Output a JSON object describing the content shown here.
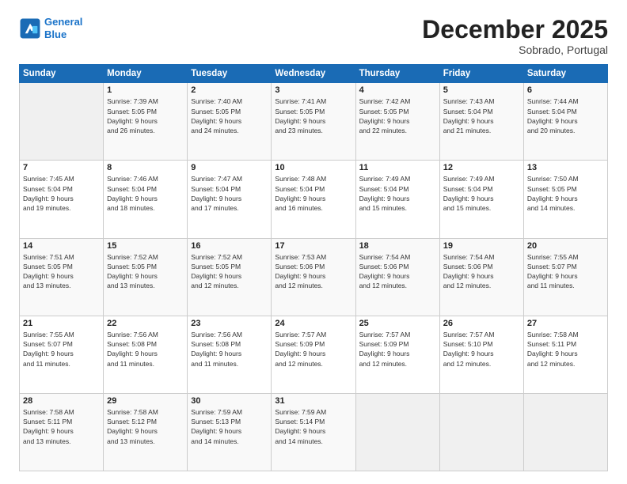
{
  "header": {
    "logo_line1": "General",
    "logo_line2": "Blue",
    "month_title": "December 2025",
    "subtitle": "Sobrado, Portugal"
  },
  "weekdays": [
    "Sunday",
    "Monday",
    "Tuesday",
    "Wednesday",
    "Thursday",
    "Friday",
    "Saturday"
  ],
  "weeks": [
    [
      {
        "day": "",
        "info": ""
      },
      {
        "day": "1",
        "info": "Sunrise: 7:39 AM\nSunset: 5:05 PM\nDaylight: 9 hours\nand 26 minutes."
      },
      {
        "day": "2",
        "info": "Sunrise: 7:40 AM\nSunset: 5:05 PM\nDaylight: 9 hours\nand 24 minutes."
      },
      {
        "day": "3",
        "info": "Sunrise: 7:41 AM\nSunset: 5:05 PM\nDaylight: 9 hours\nand 23 minutes."
      },
      {
        "day": "4",
        "info": "Sunrise: 7:42 AM\nSunset: 5:05 PM\nDaylight: 9 hours\nand 22 minutes."
      },
      {
        "day": "5",
        "info": "Sunrise: 7:43 AM\nSunset: 5:04 PM\nDaylight: 9 hours\nand 21 minutes."
      },
      {
        "day": "6",
        "info": "Sunrise: 7:44 AM\nSunset: 5:04 PM\nDaylight: 9 hours\nand 20 minutes."
      }
    ],
    [
      {
        "day": "7",
        "info": "Sunrise: 7:45 AM\nSunset: 5:04 PM\nDaylight: 9 hours\nand 19 minutes."
      },
      {
        "day": "8",
        "info": "Sunrise: 7:46 AM\nSunset: 5:04 PM\nDaylight: 9 hours\nand 18 minutes."
      },
      {
        "day": "9",
        "info": "Sunrise: 7:47 AM\nSunset: 5:04 PM\nDaylight: 9 hours\nand 17 minutes."
      },
      {
        "day": "10",
        "info": "Sunrise: 7:48 AM\nSunset: 5:04 PM\nDaylight: 9 hours\nand 16 minutes."
      },
      {
        "day": "11",
        "info": "Sunrise: 7:49 AM\nSunset: 5:04 PM\nDaylight: 9 hours\nand 15 minutes."
      },
      {
        "day": "12",
        "info": "Sunrise: 7:49 AM\nSunset: 5:04 PM\nDaylight: 9 hours\nand 15 minutes."
      },
      {
        "day": "13",
        "info": "Sunrise: 7:50 AM\nSunset: 5:05 PM\nDaylight: 9 hours\nand 14 minutes."
      }
    ],
    [
      {
        "day": "14",
        "info": "Sunrise: 7:51 AM\nSunset: 5:05 PM\nDaylight: 9 hours\nand 13 minutes."
      },
      {
        "day": "15",
        "info": "Sunrise: 7:52 AM\nSunset: 5:05 PM\nDaylight: 9 hours\nand 13 minutes."
      },
      {
        "day": "16",
        "info": "Sunrise: 7:52 AM\nSunset: 5:05 PM\nDaylight: 9 hours\nand 12 minutes."
      },
      {
        "day": "17",
        "info": "Sunrise: 7:53 AM\nSunset: 5:06 PM\nDaylight: 9 hours\nand 12 minutes."
      },
      {
        "day": "18",
        "info": "Sunrise: 7:54 AM\nSunset: 5:06 PM\nDaylight: 9 hours\nand 12 minutes."
      },
      {
        "day": "19",
        "info": "Sunrise: 7:54 AM\nSunset: 5:06 PM\nDaylight: 9 hours\nand 12 minutes."
      },
      {
        "day": "20",
        "info": "Sunrise: 7:55 AM\nSunset: 5:07 PM\nDaylight: 9 hours\nand 11 minutes."
      }
    ],
    [
      {
        "day": "21",
        "info": "Sunrise: 7:55 AM\nSunset: 5:07 PM\nDaylight: 9 hours\nand 11 minutes."
      },
      {
        "day": "22",
        "info": "Sunrise: 7:56 AM\nSunset: 5:08 PM\nDaylight: 9 hours\nand 11 minutes."
      },
      {
        "day": "23",
        "info": "Sunrise: 7:56 AM\nSunset: 5:08 PM\nDaylight: 9 hours\nand 11 minutes."
      },
      {
        "day": "24",
        "info": "Sunrise: 7:57 AM\nSunset: 5:09 PM\nDaylight: 9 hours\nand 12 minutes."
      },
      {
        "day": "25",
        "info": "Sunrise: 7:57 AM\nSunset: 5:09 PM\nDaylight: 9 hours\nand 12 minutes."
      },
      {
        "day": "26",
        "info": "Sunrise: 7:57 AM\nSunset: 5:10 PM\nDaylight: 9 hours\nand 12 minutes."
      },
      {
        "day": "27",
        "info": "Sunrise: 7:58 AM\nSunset: 5:11 PM\nDaylight: 9 hours\nand 12 minutes."
      }
    ],
    [
      {
        "day": "28",
        "info": "Sunrise: 7:58 AM\nSunset: 5:11 PM\nDaylight: 9 hours\nand 13 minutes."
      },
      {
        "day": "29",
        "info": "Sunrise: 7:58 AM\nSunset: 5:12 PM\nDaylight: 9 hours\nand 13 minutes."
      },
      {
        "day": "30",
        "info": "Sunrise: 7:59 AM\nSunset: 5:13 PM\nDaylight: 9 hours\nand 14 minutes."
      },
      {
        "day": "31",
        "info": "Sunrise: 7:59 AM\nSunset: 5:14 PM\nDaylight: 9 hours\nand 14 minutes."
      },
      {
        "day": "",
        "info": ""
      },
      {
        "day": "",
        "info": ""
      },
      {
        "day": "",
        "info": ""
      }
    ]
  ]
}
